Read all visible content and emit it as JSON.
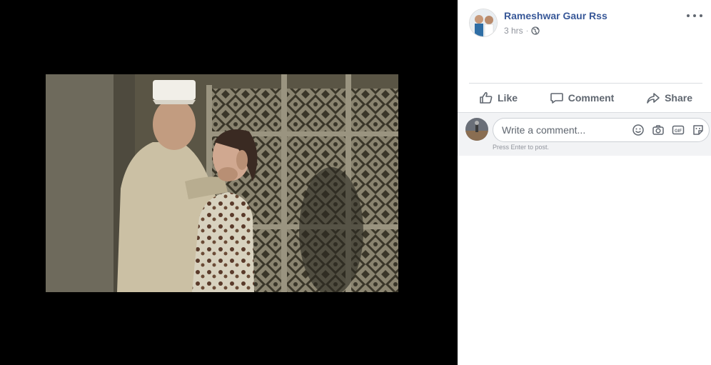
{
  "post": {
    "author": "Rameshwar Gaur Rss",
    "time": "3 hrs",
    "separator": "·"
  },
  "actions": {
    "like": "Like",
    "comment": "Comment",
    "share": "Share"
  },
  "comment_box": {
    "placeholder": "Write a comment...",
    "hint": "Press Enter to post."
  },
  "icons": {
    "privacy": "globe-icon",
    "more": "more-options-icon",
    "like": "thumbs-up-icon",
    "comment": "speech-bubble-icon",
    "share": "share-arrow-icon",
    "emoji": "emoji-icon",
    "camera": "camera-icon",
    "gif": "gif-icon",
    "sticker": "sticker-icon"
  },
  "colors": {
    "author_link": "#385898",
    "secondary_text": "#90949c",
    "action_text": "#606770",
    "viewer_bg": "#000000",
    "comment_bg": "#f2f3f5"
  }
}
